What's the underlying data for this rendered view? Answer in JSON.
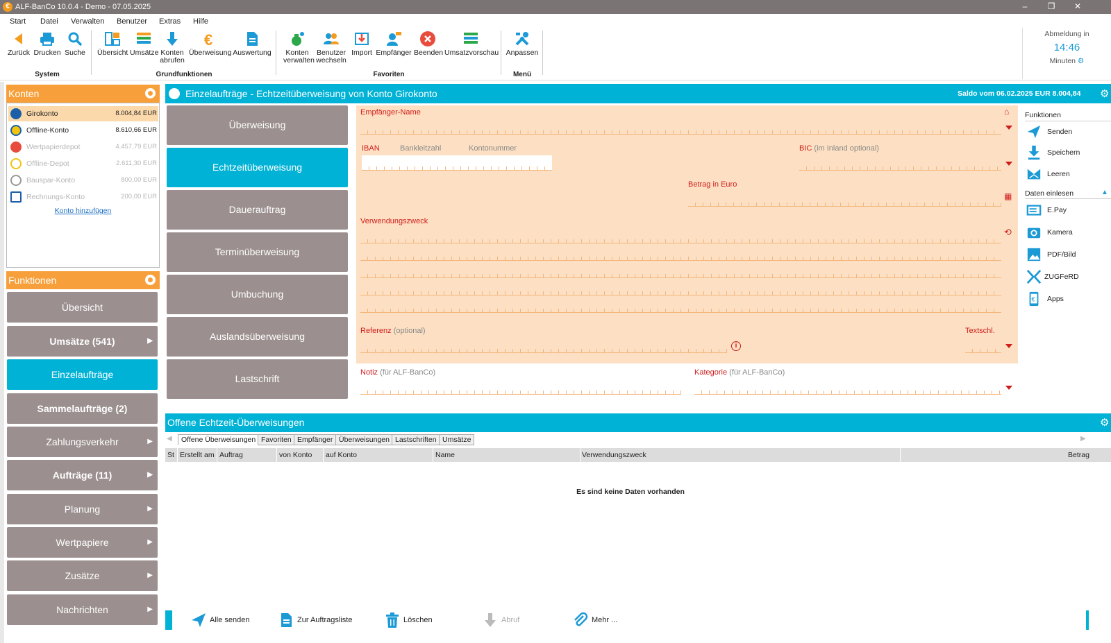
{
  "titlebar": {
    "title": "ALF-BanCo 10.0.4 - Demo - 07.05.2025"
  },
  "menu": [
    "Start",
    "Datei",
    "Verwalten",
    "Benutzer",
    "Extras",
    "Hilfe"
  ],
  "ribbon": {
    "system": {
      "label": "System",
      "buttons": [
        "Zurück",
        "Drucken",
        "Suche"
      ]
    },
    "grund": {
      "label": "Grundfunktionen",
      "buttons": [
        "Übersicht",
        "Umsätze",
        "Konten abrufen",
        "Überweisung",
        "Auswertung"
      ]
    },
    "fav": {
      "label": "Favoriten",
      "buttons": [
        "Konten verwalten",
        "Benutzer wechseln",
        "Import",
        "Empfänger",
        "Beenden",
        "Umsatzvorschau"
      ]
    },
    "menu": {
      "label": "Menü",
      "buttons": [
        "Anpassen"
      ]
    }
  },
  "session": {
    "label": "Abmeldung in",
    "time": "14:46",
    "unit": "Minuten"
  },
  "konten": {
    "title": "Konten",
    "add_link": "Konto hinzufügen",
    "accounts": [
      {
        "name": "Girokonto",
        "amount": "8.004,84 EUR",
        "icon": "volksbank-icon"
      },
      {
        "name": "Offline-Konto",
        "amount": "8.610,66 EUR",
        "icon": "offline-icon"
      },
      {
        "name": "Wertpapierdepot",
        "amount": "4.457,79 EUR",
        "icon": "sparkasse-icon"
      },
      {
        "name": "Offline-Depot",
        "amount": "2.611,30 EUR",
        "icon": "offline-depot-icon"
      },
      {
        "name": "Bauspar-Konto",
        "amount": "800,00 EUR",
        "icon": "bank-icon"
      },
      {
        "name": "Rechnungs-Konto",
        "amount": "200,00 EUR",
        "icon": "invoice-icon"
      }
    ]
  },
  "funktionen": {
    "title": "Funktionen",
    "items": [
      "Übersicht",
      "Umsätze (541)",
      "Einzelaufträge",
      "Sammelaufträge (2)",
      "Zahlungsverkehr",
      "Aufträge (11)",
      "Planung",
      "Wertpapiere",
      "Zusätze",
      "Nachrichten"
    ]
  },
  "main": {
    "title": "Einzelaufträge - Echtzeitüberweisung von Konto Girokonto",
    "saldo": "Saldo vom 06.02.2025 EUR 8.004,84"
  },
  "types": [
    "Überweisung",
    "Echtzeitüberweisung",
    "Dauerauftrag",
    "Terminüberweisung",
    "Umbuchung",
    "Auslandsüberweisung",
    "Lastschrift"
  ],
  "form": {
    "empfaenger": "Empfänger-Name",
    "iban": "IBAN",
    "blz": "Bankleitzahl",
    "ktonr": "Kontonummer",
    "bic": "BIC",
    "bic_hint": "(im Inland optional)",
    "betrag": "Betrag in Euro",
    "zweck": "Verwendungszweck",
    "referenz": "Referenz",
    "referenz_hint": "(optional)",
    "textschl": "Textschl.",
    "notiz": "Notiz",
    "notiz_hint": "(für ALF-BanCo)",
    "kategorie": "Kategorie",
    "kategorie_hint": "(für ALF-BanCo)"
  },
  "fnpanel": {
    "title": "Funktionen",
    "items": [
      "Senden",
      "Speichern",
      "Leeren"
    ],
    "import_title": "Daten einlesen",
    "import_items": [
      "E.Pay",
      "Kamera",
      "PDF/Bild",
      "ZUGFeRD",
      "Apps"
    ]
  },
  "offene": {
    "title": "Offene Echtzeit-Überweisungen",
    "tabs": [
      "Offene Überweisungen",
      "Favoriten",
      "Empfänger",
      "Überweisungen",
      "Lastschriften",
      "Umsätze"
    ],
    "columns": [
      "St",
      "Erstellt am",
      "Auftrag",
      "von Konto",
      "auf Konto",
      "Name",
      "Verwendungszweck",
      "Betrag"
    ],
    "empty": "Es sind keine Daten vorhanden"
  },
  "bottom": [
    "Alle senden",
    "Zur Auftragsliste",
    "Löschen",
    "Abruf",
    "Mehr ..."
  ],
  "colors": {
    "accent": "#00b2d6",
    "orange": "#f7a03b",
    "button": "#9b8f8f",
    "form": "#fde0c3",
    "red": "#d01c1c"
  }
}
